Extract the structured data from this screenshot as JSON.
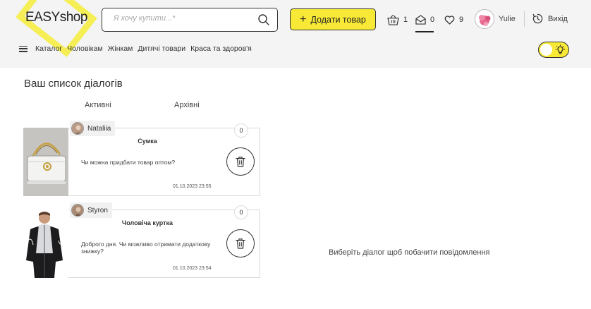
{
  "brand": {
    "logo_main": "EASY",
    "logo_sub": "shop"
  },
  "search": {
    "placeholder": "Я хочу купити...*"
  },
  "header": {
    "add_product_label": "Додати товар",
    "cart_count": "1",
    "messages_count": "0",
    "favorites_count": "9",
    "user_name": "Yulie",
    "logout_label": "Вихід"
  },
  "categories": [
    "Каталог",
    "Чоловікам",
    "Жінкам",
    "Дитячі товари",
    "Краса та здоров'я"
  ],
  "page": {
    "title": "Ваш список діалогів",
    "tabs": [
      "Активні",
      "Архівні"
    ],
    "empty_note": "Виберіть діалог щоб побачити повідомлення"
  },
  "dialogs": [
    {
      "author": "Nataliia",
      "count": "0",
      "title": "Сумка",
      "message": "Чи можна придбати товар оптом?",
      "date": "01.10.2023 23:55"
    },
    {
      "author": "Styron",
      "count": "0",
      "title": "Чоловіча куртка",
      "message": "Доброго дня. Чи можливо отримати додаткову знижку?",
      "date": "01.10.2023 23:54"
    }
  ],
  "colors": {
    "accent": "#f8e936",
    "text": "#222222",
    "topbar_bg": "#f4f4f4"
  },
  "icons": [
    "search-icon",
    "plus-icon",
    "basket-icon",
    "envelope-icon",
    "heart-icon",
    "logout-icon",
    "menu-icon",
    "lightbulb-icon",
    "trash-icon"
  ]
}
